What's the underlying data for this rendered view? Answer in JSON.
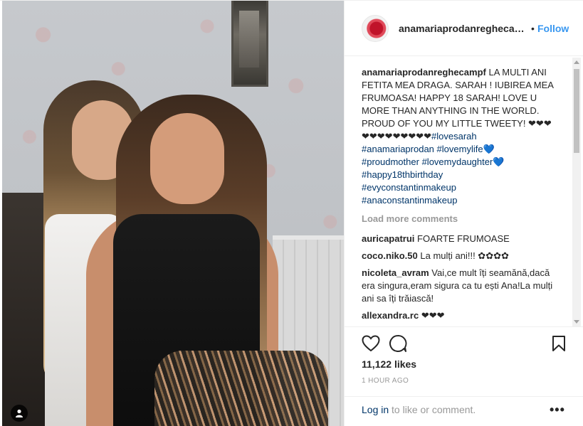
{
  "header": {
    "username": "anamariaprodanreghecam...",
    "separator": "•",
    "follow_label": "Follow"
  },
  "caption": {
    "username": "anamariaprodanreghecampf",
    "text": "LA MULTI ANI FETITA MEA DRAGA. SARAH ! IUBIREA MEA FRUMOASA! HAPPY 18 SARAH! LOVE U MORE THAN ANYTHING IN THE WORLD. PROUD OF YOU MY LITTLE TWEETY! ❤❤❤ ❤❤❤❤❤❤❤❤❤",
    "hashtags": [
      "#lovesarah",
      "#anamariaprodan",
      "#lovemylife💙",
      "#proudmother",
      "#lovemydaughter💙",
      "#happy18thbirthday",
      "#evyconstantinmakeup",
      "#anaconstantinmakeup"
    ]
  },
  "load_more_label": "Load more comments",
  "comments": [
    {
      "username": "auricapatrui",
      "text": "FOARTE FRUMOASE"
    },
    {
      "username": "coco.niko.50",
      "text": "La mulți ani!!! ✿✿✿✿"
    },
    {
      "username": "nicoleta_avram",
      "text": "Vai,ce mult îți seamănă,dacă era singura,eram sigura ca tu ești Ana!La mulți ani sa îți trăiască!"
    },
    {
      "username": "allexandra.rc",
      "text": "❤❤❤"
    }
  ],
  "actions": {
    "like_icon": "heart-icon",
    "comment_icon": "comment-icon",
    "save_icon": "bookmark-icon"
  },
  "likes_text": "11,122 likes",
  "time_text": "1 HOUR AGO",
  "footer": {
    "login_link": "Log in",
    "login_rest": " to like or comment.",
    "more_label": "•••"
  },
  "colors": {
    "link_blue": "#3897f0",
    "hashtag_navy": "#003569",
    "muted_gray": "#999999",
    "text_dark": "#262626"
  }
}
